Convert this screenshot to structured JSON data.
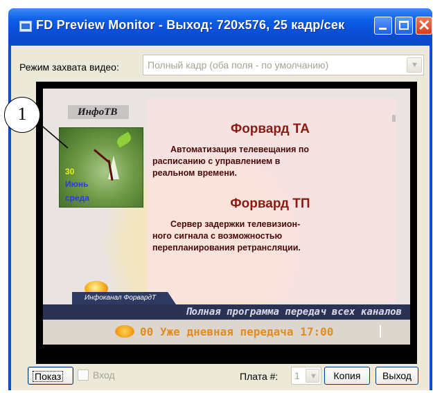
{
  "window": {
    "title": "FD Preview Monitor - Выход: 720x576, 25 кадр/сек",
    "title_icon": "monitor-icon",
    "buttons": [
      "minimize-icon",
      "maximize-icon",
      "close-icon"
    ]
  },
  "capture": {
    "label": "Режим захвата видео:",
    "value": "Полный кадр (оба поля - по умолчанию)"
  },
  "preview": {
    "logo": "ИнфоТВ",
    "date": {
      "day": "30",
      "month": "Июнь",
      "weekday": "среда"
    },
    "heading1": "Форвард ТА",
    "para1_lines": [
      "Автоматизация телевещания по",
      "расписанию с управлением в",
      "реальном времени."
    ],
    "heading2": "Форвард ТП",
    "para2_lines": [
      "Сервер задержки телевизион-",
      "ного сигнала с возможностью",
      "перепланирования ретрансляции."
    ],
    "channel_tab": "Инфоканал ФорвардТ",
    "ticker": "Полная программа передач всех каналов",
    "ticker2": "00 Уже дневная передача 17:00"
  },
  "callout": {
    "number": "1"
  },
  "bottom": {
    "show_button": "Показ",
    "input_checkbox_label": "Вход",
    "input_checked": false,
    "board_label": "Плата #:",
    "board_value": "1",
    "copy_button": "Копия",
    "exit_button": "Выход"
  },
  "colors": {
    "titlebar": "#0a50d8",
    "client_bg": "#ece9d8",
    "heading": "#8a1a12",
    "ticker_bg": "#2c3254"
  }
}
